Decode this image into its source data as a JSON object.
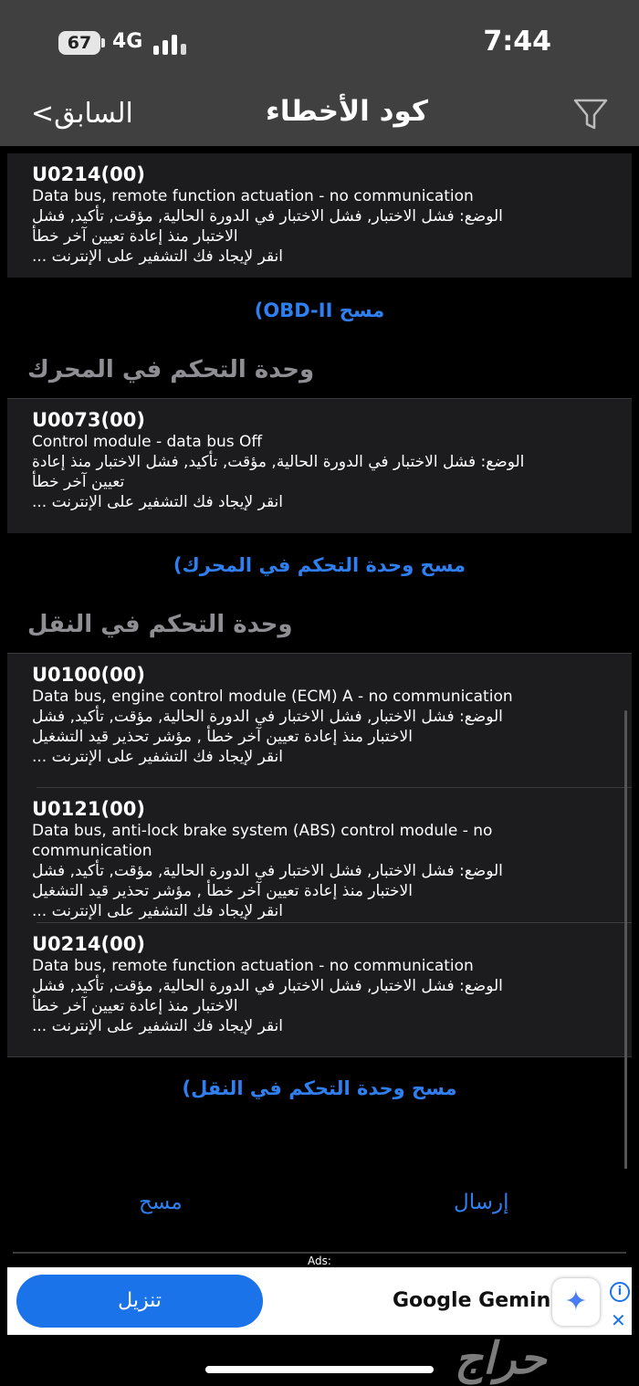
{
  "status_bar": {
    "battery": "67",
    "network": "4G",
    "time": "7:44"
  },
  "nav": {
    "back_label": "<السابق",
    "title": "كود الأخطاء"
  },
  "group_top": {
    "card": {
      "code": "U0214(00)",
      "description": "Data bus, remote function actuation - no communication",
      "status_lines": [
        "الوضع: فشل الاختبار, فشل الاختبار في الدورة الحالية, مؤقت, تأكيد, فشل",
        "الاختبار منذ إعادة تعيين آخر خطأ"
      ],
      "lookup": "انقر لإيجاد فك التشفير على الإنترنت ..."
    },
    "clear_label": "مسح  OBD-II)"
  },
  "group_engine": {
    "section_title": "وحدة التحكم في المحرك",
    "card": {
      "code": "U0073(00)",
      "description": "Control module - data bus Off",
      "status_lines": [
        "الوضع: فشل الاختبار في الدورة الحالية, مؤقت, تأكيد, فشل الاختبار منذ إعادة",
        "تعيين آخر خطأ"
      ],
      "lookup": "انقر لإيجاد فك التشفير على الإنترنت ..."
    },
    "clear_label": "مسح  وحدة التحكم في المحرك)"
  },
  "group_transmission": {
    "section_title": "وحدة التحكم في النقل",
    "cards": [
      {
        "code": "U0100(00)",
        "description": "Data bus, engine control module (ECM) A - no communication",
        "status_lines": [
          "الوضع: فشل الاختبار, فشل الاختبار في الدورة الحالية, مؤقت, تأكيد, فشل",
          "الاختبار منذ إعادة تعيين آخر خطأ , مؤشر تحذير قيد التشغيل"
        ],
        "lookup": "انقر لإيجاد فك التشفير على الإنترنت ..."
      },
      {
        "code": "U0121(00)",
        "description": "Data bus, anti-lock brake system (ABS) control module - no communication",
        "status_lines": [
          "الوضع: فشل الاختبار, فشل الاختبار في الدورة الحالية, مؤقت, تأكيد, فشل",
          "الاختبار منذ إعادة تعيين آخر خطأ , مؤشر تحذير قيد التشغيل"
        ],
        "lookup": "انقر لإيجاد فك التشفير على الإنترنت ..."
      },
      {
        "code": "U0214(00)",
        "description": "Data bus, remote function actuation - no communication",
        "status_lines": [
          "الوضع: فشل الاختبار, فشل الاختبار في الدورة الحالية, مؤقت, تأكيد, فشل",
          "الاختبار منذ إعادة تعيين آخر خطأ"
        ],
        "lookup": "انقر لإيجاد فك التشفير على الإنترنت ..."
      }
    ],
    "clear_label": "مسح  وحدة التحكم في النقل)"
  },
  "bottom_bar": {
    "send_label": "إرسال",
    "clear_label": "مسح"
  },
  "ad": {
    "label": "Ads:",
    "app_name": "Google Gemini",
    "download_label": "تنزيل",
    "info_glyph": "i",
    "close_glyph": "✕"
  },
  "watermark": "حراج",
  "colors": {
    "accent": "#2f7ff0",
    "card_bg": "#1c1c1e",
    "bar_bg": "#404040",
    "section_text": "#8e8e93"
  }
}
